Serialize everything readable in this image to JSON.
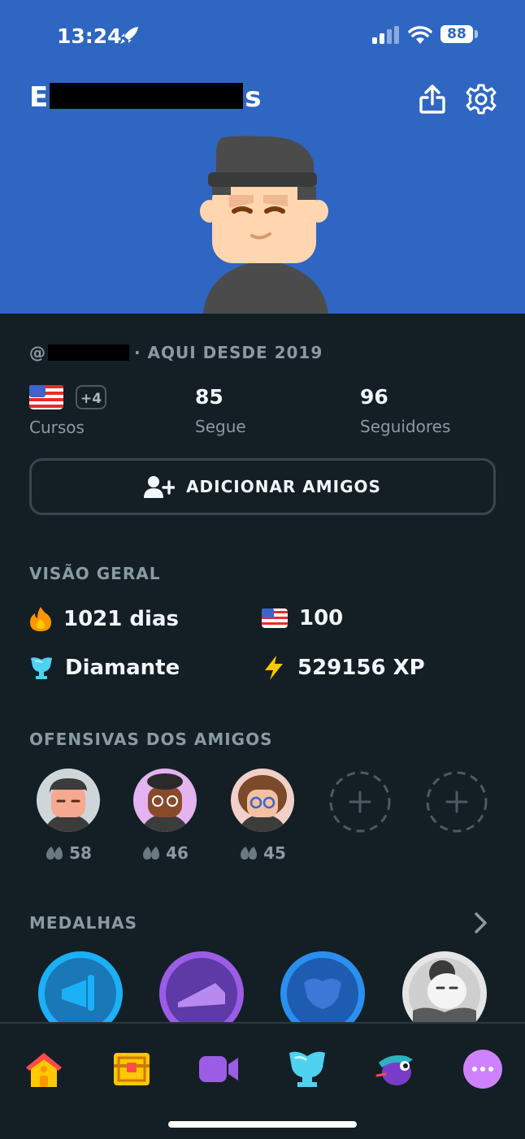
{
  "status_bar": {
    "time": "13:24",
    "battery": "88"
  },
  "profile": {
    "name_start": "E",
    "name_end": "s",
    "handle_prefix": "@",
    "joined": "· AQUI DESDE 2019"
  },
  "stats": {
    "courses_extra": "+4",
    "courses_label": "Cursos",
    "following_value": "85",
    "following_label": "Segue",
    "followers_value": "96",
    "followers_label": "Seguidores"
  },
  "add_friends_label": "ADICIONAR AMIGOS",
  "overview": {
    "title": "VISÃO GERAL",
    "streak": "1021 dias",
    "course_score": "100",
    "league": "Diamante",
    "xp": "529156 XP"
  },
  "friend_streaks": {
    "title": "OFENSIVAS DOS AMIGOS",
    "friends": [
      {
        "streak": "58"
      },
      {
        "streak": "46"
      },
      {
        "streak": "45"
      }
    ]
  },
  "medals": {
    "title": "MEDALHAS"
  },
  "colors": {
    "header_blue": "#2e66c2",
    "background": "#141f25",
    "muted_text": "#8a9aa3",
    "streak_orange": "#ff9600",
    "xp_yellow": "#ffc800",
    "diamond_cyan": "#4fd1f0"
  },
  "tabs": [
    "home-icon",
    "chest-icon",
    "video-icon",
    "league-icon",
    "practice-icon",
    "more-icon"
  ]
}
